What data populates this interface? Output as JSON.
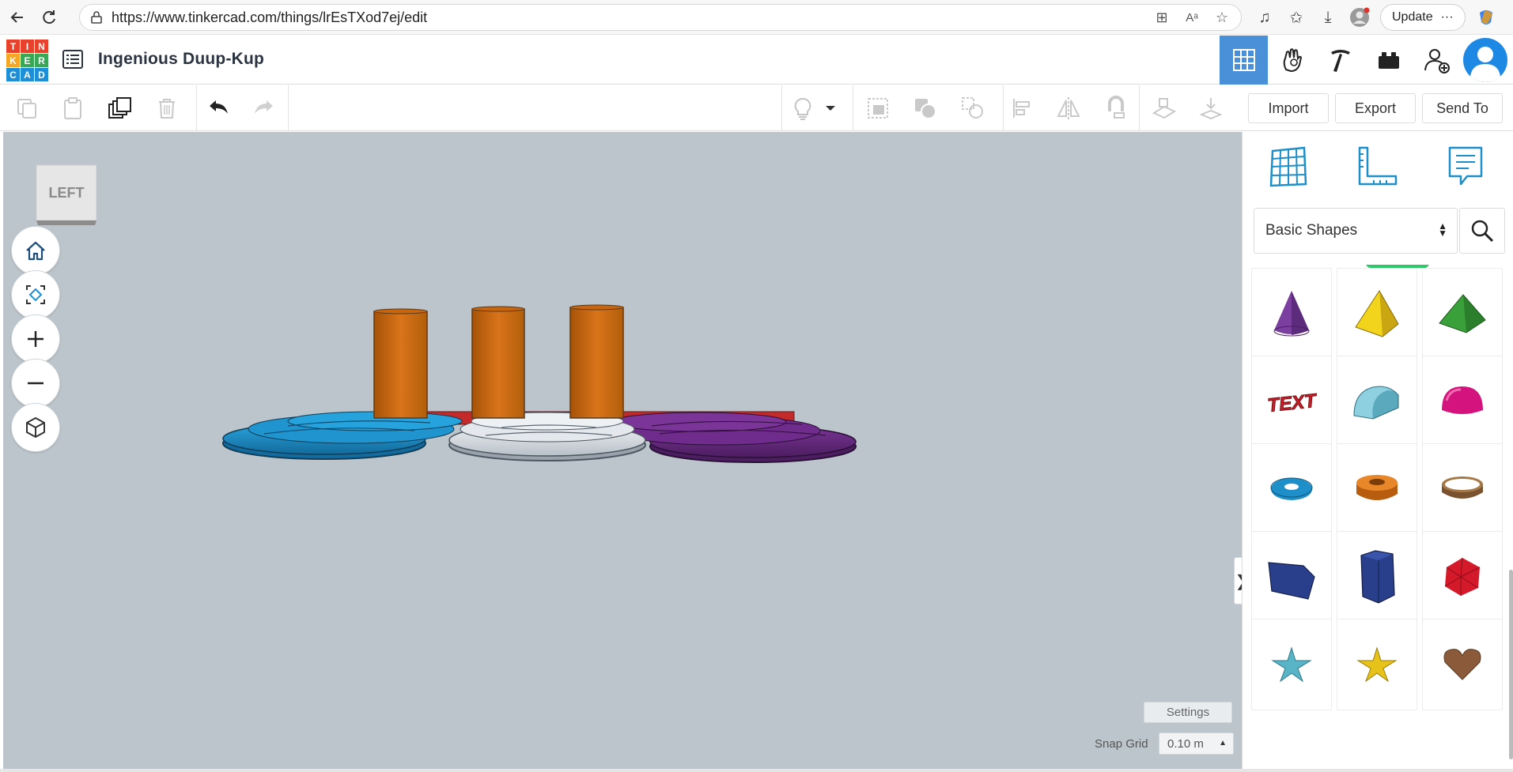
{
  "browser": {
    "url": "https://www.tinkercad.com/things/lrEsTXod7ej/edit",
    "update_label": "Update",
    "more_label": "···"
  },
  "header": {
    "logo_letters": [
      "T",
      "I",
      "N",
      "K",
      "E",
      "R",
      "C",
      "A",
      "D"
    ],
    "logo_colors": [
      "#e8412c",
      "#e8412c",
      "#e8412c",
      "#f5a623",
      "#3aa757",
      "#3aa757",
      "#1e8fd6",
      "#1e8fd6",
      "#1e8fd6"
    ],
    "design_title": "Ingenious Duup-Kup",
    "right_buttons": [
      "grid-view-icon",
      "hand-icon",
      "pickaxe-icon",
      "brick-icon",
      "add-user-icon",
      "profile-avatar"
    ]
  },
  "toolbar": {
    "buttons_left": [
      "copy-icon",
      "paste-icon",
      "duplicate-icon",
      "delete-icon",
      "undo-icon",
      "redo-icon"
    ],
    "buttons_right": [
      "light-bulb-icon",
      "dropdown-caret-icon",
      "group-icon",
      "ungroup-icon",
      "hole-icon",
      "align-icon",
      "mirror-icon",
      "cruise-icon",
      "workplane-icon",
      "drop-icon"
    ],
    "import_label": "Import",
    "export_label": "Export",
    "sendto_label": "Send To"
  },
  "workplane": {
    "view_cube_label": "LEFT",
    "nav_controls": [
      "home-view-icon",
      "fit-view-icon",
      "zoom-in-icon",
      "zoom-out-icon",
      "perspective-icon"
    ],
    "settings_label": "Settings",
    "snap_grid_label": "Snap Grid",
    "snap_grid_value": "0.10 m",
    "panel_toggle": "❯"
  },
  "right_panel": {
    "top_icons": [
      "workplane-grid-icon",
      "ruler-icon",
      "notes-icon"
    ],
    "library_selected": "Basic Shapes",
    "shapes": [
      {
        "name": "cone",
        "color": "#7b3fa0"
      },
      {
        "name": "pyramid",
        "color": "#e6c21a"
      },
      {
        "name": "roof",
        "color": "#3a9a3a"
      },
      {
        "name": "text",
        "color": "#c8202a",
        "label": "TEXT"
      },
      {
        "name": "half-cylinder",
        "color": "#7cc4d6"
      },
      {
        "name": "half-sphere",
        "color": "#d4137e"
      },
      {
        "name": "torus",
        "color": "#1e8fc8"
      },
      {
        "name": "tube",
        "color": "#d9731a"
      },
      {
        "name": "ring",
        "color": "#9a6b3a"
      },
      {
        "name": "polygon",
        "color": "#2a3f8c"
      },
      {
        "name": "hexagonal-prism",
        "color": "#2a3f8c"
      },
      {
        "name": "icosahedron",
        "color": "#d4192a"
      },
      {
        "name": "star-flat",
        "color": "#5ab4c8"
      },
      {
        "name": "star",
        "color": "#e6c21a"
      },
      {
        "name": "heart",
        "color": "#8a5a3a"
      }
    ]
  },
  "scene": {
    "cylinder_color": "#c8650f",
    "blue_disk_color": "#1f8cc4",
    "white_disk_color": "#d8dde2",
    "purple_disk_color": "#6a2a82",
    "red_base_color": "#d42a2a"
  }
}
